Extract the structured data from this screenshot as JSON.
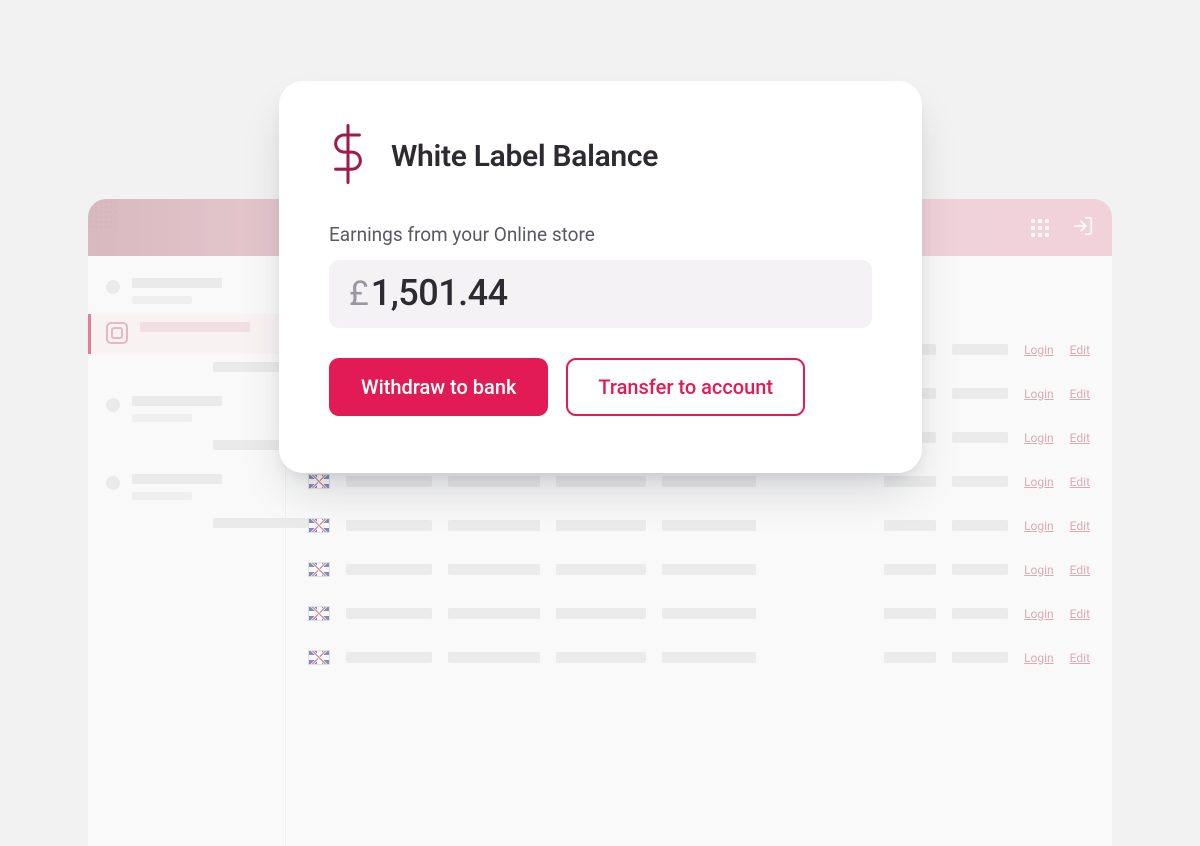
{
  "card": {
    "title": "White Label Balance",
    "subtitle": "Earnings from your Online store",
    "currency_symbol": "£",
    "balance_value": "1,501.44",
    "withdraw_label": "Withdraw to bank",
    "transfer_label": "Transfer to account"
  },
  "table": {
    "login_link": "Login",
    "edit_link": "Edit"
  },
  "colors": {
    "accent": "#e31b54"
  }
}
